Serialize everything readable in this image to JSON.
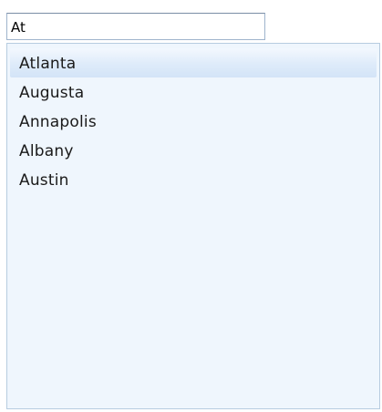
{
  "search": {
    "value": "At",
    "placeholder": ""
  },
  "suggestions": {
    "highlighted_index": 0,
    "items": [
      {
        "label": "Atlanta"
      },
      {
        "label": "Augusta"
      },
      {
        "label": "Annapolis"
      },
      {
        "label": "Albany"
      },
      {
        "label": "Austin"
      }
    ]
  },
  "colors": {
    "panel_background": "#eff6fd",
    "panel_border": "#b7cce0",
    "highlight": "#deebfa",
    "input_border": "#9fb4cc"
  }
}
